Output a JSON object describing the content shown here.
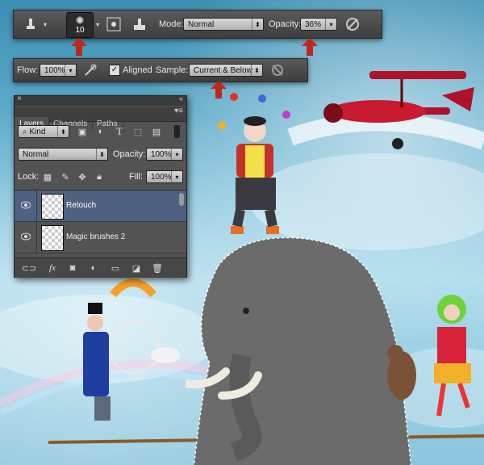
{
  "toolbar": {
    "brush_size": "10",
    "mode_label": "Mode:",
    "mode_value": "Normal",
    "opacity_label": "Opacity:",
    "opacity_value": "36%"
  },
  "toolbar2": {
    "flow_label": "Flow:",
    "flow_value": "100%",
    "aligned_label": "Aligned",
    "sample_label": "Sample:",
    "sample_value": "Current & Below"
  },
  "layers_panel": {
    "tabs": [
      "Layers",
      "Channels",
      "Paths"
    ],
    "filter_value": "Kind",
    "blend_mode": "Normal",
    "opacity_label": "Opacity:",
    "opacity_value": "100%",
    "lock_label": "Lock:",
    "fill_label": "Fill:",
    "fill_value": "100%",
    "layers": [
      {
        "name": "Retouch",
        "selected": true
      },
      {
        "name": "Magic brushes 2",
        "selected": false
      }
    ]
  },
  "colors": {
    "arrow": "#c0261c",
    "panel_bg": "#535353",
    "selected_row": "#4f6180"
  }
}
